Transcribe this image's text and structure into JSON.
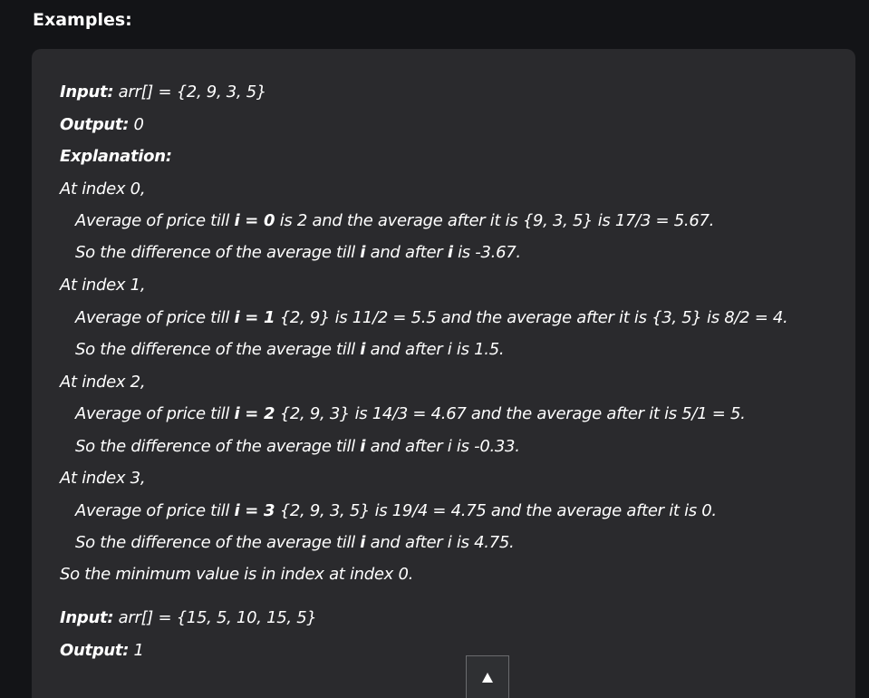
{
  "heading": "Examples:",
  "example1": {
    "input_label": "Input:",
    "input_value": " arr[] = {2, 9, 3, 5}",
    "output_label": "Output:",
    "output_value": " 0",
    "explanation_label": "Explanation:",
    "steps": [
      {
        "index_line": "At index 0,",
        "avg_pre": "Average of price till ",
        "avg_i": "i = 0",
        "avg_post": " is 2 and the average after it is {9, 3, 5} is 17/3 = 5.67.",
        "diff_pre": "So the difference of the average till ",
        "diff_i1": "i",
        "diff_mid": " and after ",
        "diff_i2": "i",
        "diff_post": " is -3.67."
      },
      {
        "index_line": "At index 1,",
        "avg_pre": "Average of price till ",
        "avg_i": "i = 1",
        "avg_post": " {2, 9} is 11/2 = 5.5 and the average after it is {3, 5} is 8/2 = 4.",
        "diff_pre": "So the difference of the average till ",
        "diff_i1": "i",
        "diff_mid": " and after i is 1.5.",
        "diff_i2": "",
        "diff_post": ""
      },
      {
        "index_line": "At index 2,",
        "avg_pre": "Average of price till ",
        "avg_i": "i = 2",
        "avg_post": " {2, 9, 3} is 14/3  = 4.67 and the average after it is 5/1 = 5.",
        "diff_pre": "So the difference of the average till ",
        "diff_i1": "i",
        "diff_mid": " and after i is -0.33.",
        "diff_i2": "",
        "diff_post": ""
      },
      {
        "index_line": "At index 3,",
        "avg_pre": "Average of price till ",
        "avg_i": "i = 3",
        "avg_post": " {2, 9, 3, 5} is 19/4 = 4.75 and the average after it is 0.",
        "diff_pre": "So the difference of the average till ",
        "diff_i1": "i",
        "diff_mid": " and after i is 4.75.",
        "diff_i2": "",
        "diff_post": ""
      }
    ],
    "conclusion": "So the minimum value is in index at index 0."
  },
  "example2": {
    "input_label": "Input:",
    "input_value": " arr[] =  {15, 5, 10, 15, 5}",
    "output_label": "Output:",
    "output_value": " 1"
  },
  "scroll_top_icon": "up-triangle"
}
